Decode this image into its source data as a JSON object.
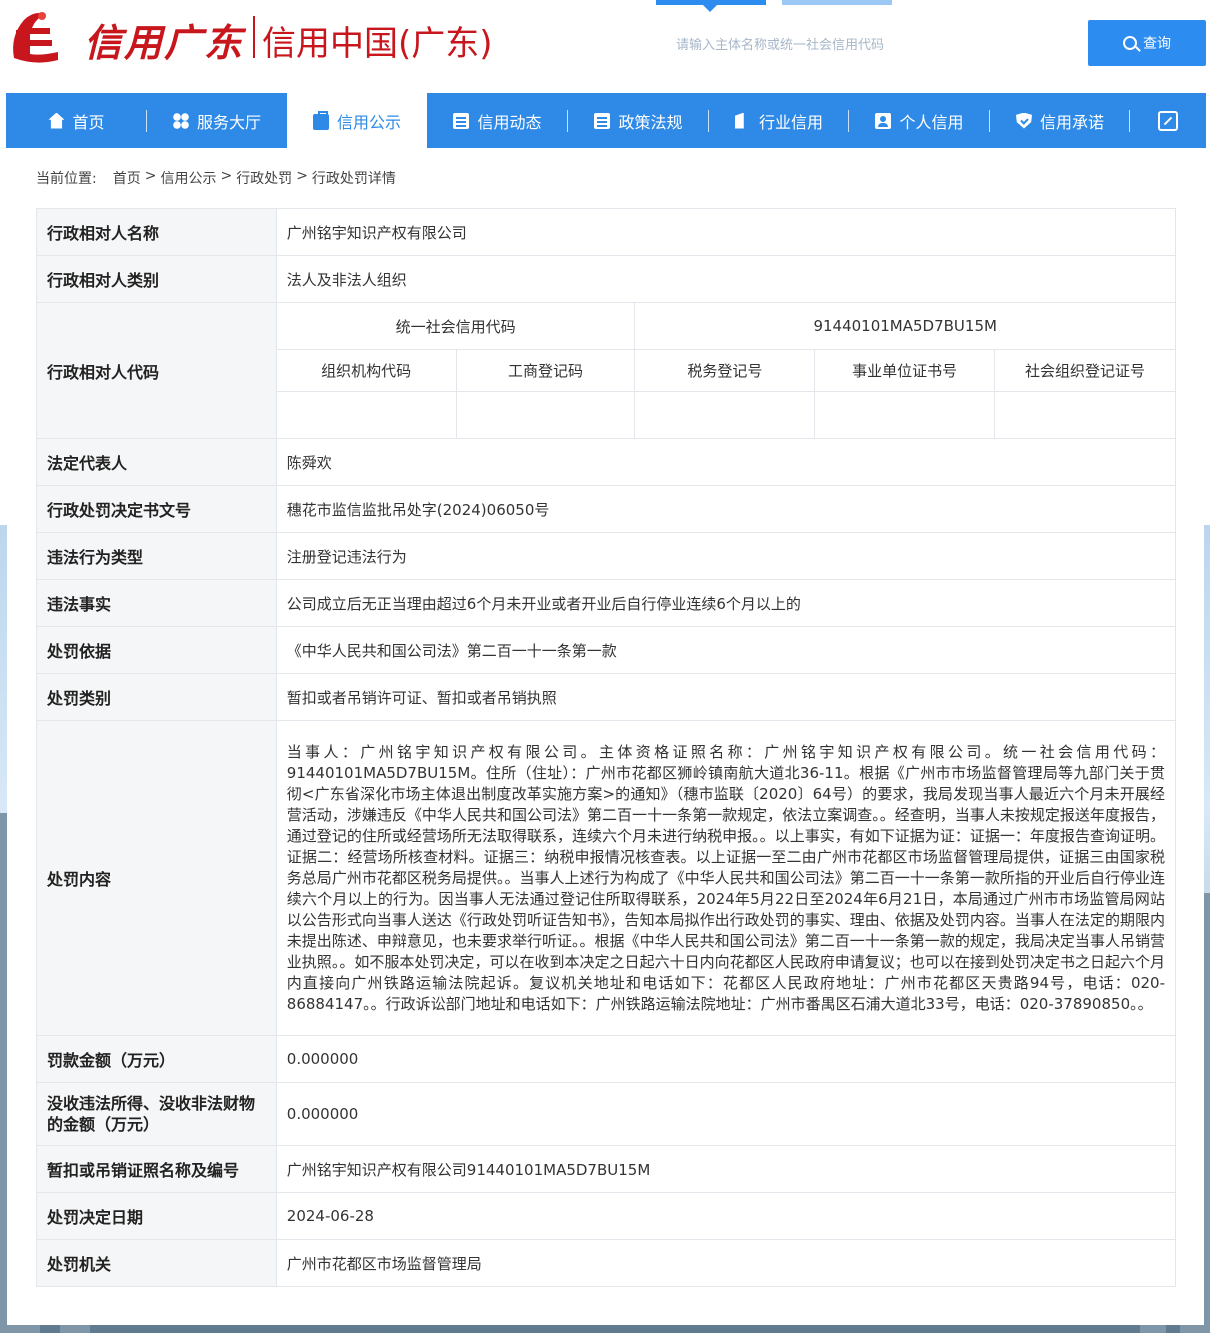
{
  "header": {
    "logo_calligraphy": "信用广东",
    "logo_text": "信用中国(广东)",
    "search_placeholder": "请输入主体名称或统一社会信用代码",
    "search_button": "查询"
  },
  "nav": {
    "items": [
      {
        "label": "首页",
        "icon": "home-icon"
      },
      {
        "label": "服务大厅",
        "icon": "grid-icon"
      },
      {
        "label": "信用公示",
        "icon": "briefcase-icon",
        "active": true
      },
      {
        "label": "信用动态",
        "icon": "document-icon"
      },
      {
        "label": "政策法规",
        "icon": "clipboard-icon"
      },
      {
        "label": "行业信用",
        "icon": "building-icon"
      },
      {
        "label": "个人信用",
        "icon": "person-card-icon"
      },
      {
        "label": "信用承诺",
        "icon": "shield-check-icon"
      }
    ],
    "expand_icon": "expand-icon"
  },
  "breadcrumb": {
    "label": "当前位置:",
    "items": [
      "首页",
      "信用公示",
      "行政处罚",
      "行政处罚详情"
    ],
    "separator": ">"
  },
  "detail": {
    "name_label": "行政相对人名称",
    "name_value": "广州铭宇知识产权有限公司",
    "type_label": "行政相对人类别",
    "type_value": "法人及非法人组织",
    "code_label": "行政相对人代码",
    "uscc_label": "统一社会信用代码",
    "uscc_value": "91440101MA5D7BU15M",
    "sub_codes": [
      "组织机构代码",
      "工商登记码",
      "税务登记号",
      "事业单位证书号",
      "社会组织登记证号"
    ],
    "legal_rep_label": "法定代表人",
    "legal_rep_value": "陈舜欢",
    "doc_no_label": "行政处罚决定书文号",
    "doc_no_value": "穗花市监信监批吊处字(2024)06050号",
    "violation_type_label": "违法行为类型",
    "violation_type_value": "注册登记违法行为",
    "violation_fact_label": "违法事实",
    "violation_fact_value": "公司成立后无正当理由超过6个月未开业或者开业后自行停业连续6个月以上的",
    "basis_label": "处罚依据",
    "basis_value": "《中华人民共和国公司法》第二百一十一条第一款",
    "category_label": "处罚类别",
    "category_value": "暂扣或者吊销许可证、暂扣或者吊销执照",
    "content_label": "处罚内容",
    "content_value": "当事人：广州铭宇知识产权有限公司。主体资格证照名称：广州铭宇知识产权有限公司。统一社会信用代码：91440101MA5D7BU15M。住所（住址）：广州市花都区狮岭镇南航大道北36-11。根据《广州市市场监督管理局等九部门关于贯彻<广东省深化市场主体退出制度改革实施方案>的通知》（穗市监联〔2020〕64号）的要求，我局发现当事人最近六个月未开展经营活动，涉嫌违反《中华人民共和国公司法》第二百一十一条第一款规定，依法立案调查。。经查明，当事人未按规定报送年度报告，通过登记的住所或经营场所无法取得联系，连续六个月未进行纳税申报。。以上事实，有如下证据为证：证据一：年度报告查询证明。证据二：经营场所核查材料。证据三：纳税申报情况核查表。以上证据一至二由广州市花都区市场监督管理局提供，证据三由国家税务总局广州市花都区税务局提供。。当事人上述行为构成了《中华人民共和国公司法》第二百一十一条第一款所指的开业后自行停业连续六个月以上的行为。因当事人无法通过登记住所取得联系，2024年5月22日至2024年6月21日，本局通过广州市市场监管局网站以公告形式向当事人送达《行政处罚听证告知书》，告知本局拟作出行政处罚的事实、理由、依据及处罚内容。当事人在法定的期限内未提出陈述、申辩意见，也未要求举行听证。。根据《中华人民共和国公司法》第二百一十一条第一款的规定，我局决定当事人吊销营业执照。。如不服本处罚决定，可以在收到本决定之日起六十日内向花都区人民政府申请复议；也可以在接到处罚决定书之日起六个月内直接向广州铁路运输法院起诉。复议机关地址和电话如下：花都区人民政府地址：广州市花都区天贵路94号，电话：020-86884147。。行政诉讼部门地址和电话如下：广州铁路运输法院地址：广州市番禺区石浦大道北33号，电话：020-37890850。。",
    "fine_label": "罚款金额（万元）",
    "fine_value": "0.000000",
    "confiscation_label": "没收违法所得、没收非法财物的金额（万元）",
    "confiscation_value": "0.000000",
    "license_label": "暂扣或吊销证照名称及编号",
    "license_value": "广州铭宇知识产权有限公司91440101MA5D7BU15M",
    "date_label": "处罚决定日期",
    "date_value": "2024-06-28",
    "authority_label": "处罚机关",
    "authority_value": "广州市花都区市场监督管理局"
  }
}
